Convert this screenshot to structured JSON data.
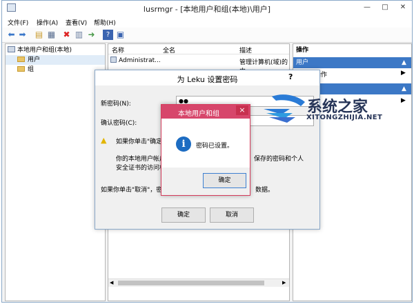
{
  "window": {
    "title": "lusrmgr - [本地用户和组(本地)\\用户]"
  },
  "menus": [
    "文件(F)",
    "操作(A)",
    "查看(V)",
    "帮助(H)"
  ],
  "tree": {
    "root": "本地用户和组(本地)",
    "items": [
      "用户",
      "组"
    ]
  },
  "list": {
    "columns": [
      "名称",
      "全名",
      "描述"
    ],
    "rows": [
      {
        "name": "Administrat...",
        "desc": "管理计算机(域)的内"
      }
    ]
  },
  "actions": {
    "header": "操作",
    "section1": "用户",
    "item1": "多操作"
  },
  "dialog": {
    "title": "为 Leku 设置密码",
    "help": "?",
    "new_label": "新密码(N):",
    "new_value": "●●",
    "confirm_label": "确认密码(C):",
    "warn1": "如果你单击\"确定",
    "warn1_tail": "件，保存的密码和个人",
    "para1": "你的本地用户帐户",
    "para2": "安全证书的访问权",
    "cancel_note_a": "如果你单击\"取消\"，密",
    "cancel_note_b": "数据。",
    "ok": "确定",
    "cancel": "取消"
  },
  "msgbox": {
    "title": "本地用户和组",
    "text": "密码已设置。",
    "ok": "确定",
    "close": "×"
  },
  "watermark": {
    "text": "系统之家",
    "sub": "XITONGZHIJIA.NET"
  }
}
